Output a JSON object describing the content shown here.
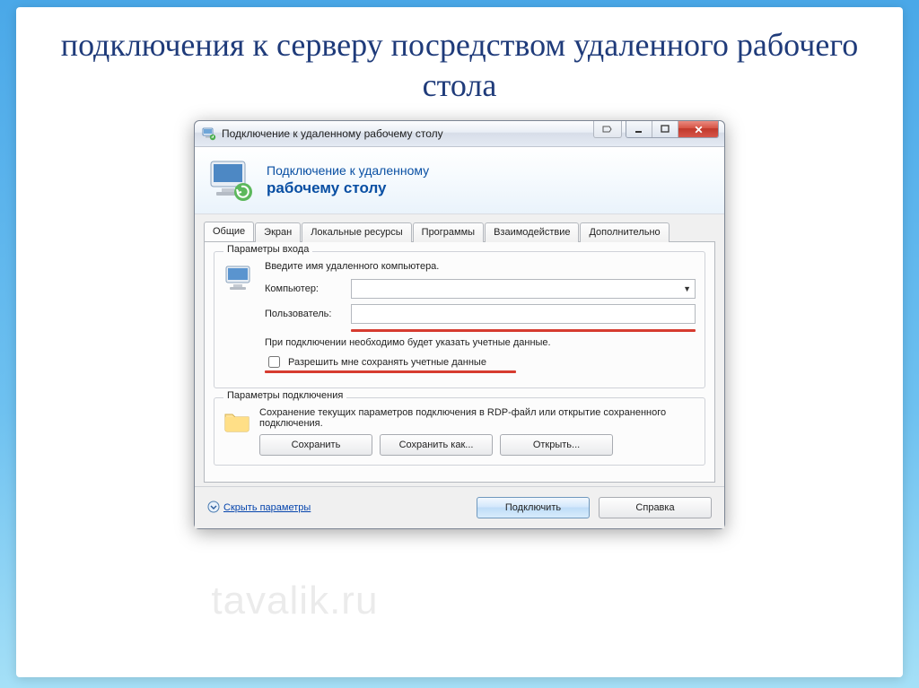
{
  "slide": {
    "title": "подключения к серверу посредством удаленного рабочего стола"
  },
  "dialog": {
    "title": "Подключение к удаленному рабочему столу",
    "banner_line1": "Подключение к удаленному",
    "banner_line2": "рабочему столу",
    "tabs": [
      {
        "label": "Общие",
        "active": true
      },
      {
        "label": "Экран",
        "active": false
      },
      {
        "label": "Локальные ресурсы",
        "active": false
      },
      {
        "label": "Программы",
        "active": false
      },
      {
        "label": "Взаимодействие",
        "active": false
      },
      {
        "label": "Дополнительно",
        "active": false
      }
    ],
    "login_group": {
      "title": "Параметры входа",
      "instruction": "Введите имя удаленного компьютера.",
      "computer_label": "Компьютер:",
      "computer_value": "",
      "user_label": "Пользователь:",
      "user_value": "",
      "creds_note": "При подключении необходимо будет указать учетные данные.",
      "allow_save_label": "Разрешить мне сохранять учетные данные"
    },
    "conn_group": {
      "title": "Параметры подключения",
      "desc": "Сохранение текущих параметров подключения в RDP-файл или открытие сохраненного подключения.",
      "save": "Сохранить",
      "save_as": "Сохранить как...",
      "open": "Открыть..."
    },
    "footer": {
      "hide_params": "Скрыть параметры",
      "connect": "Подключить",
      "help": "Справка"
    }
  },
  "watermark": "tavalik.ru"
}
